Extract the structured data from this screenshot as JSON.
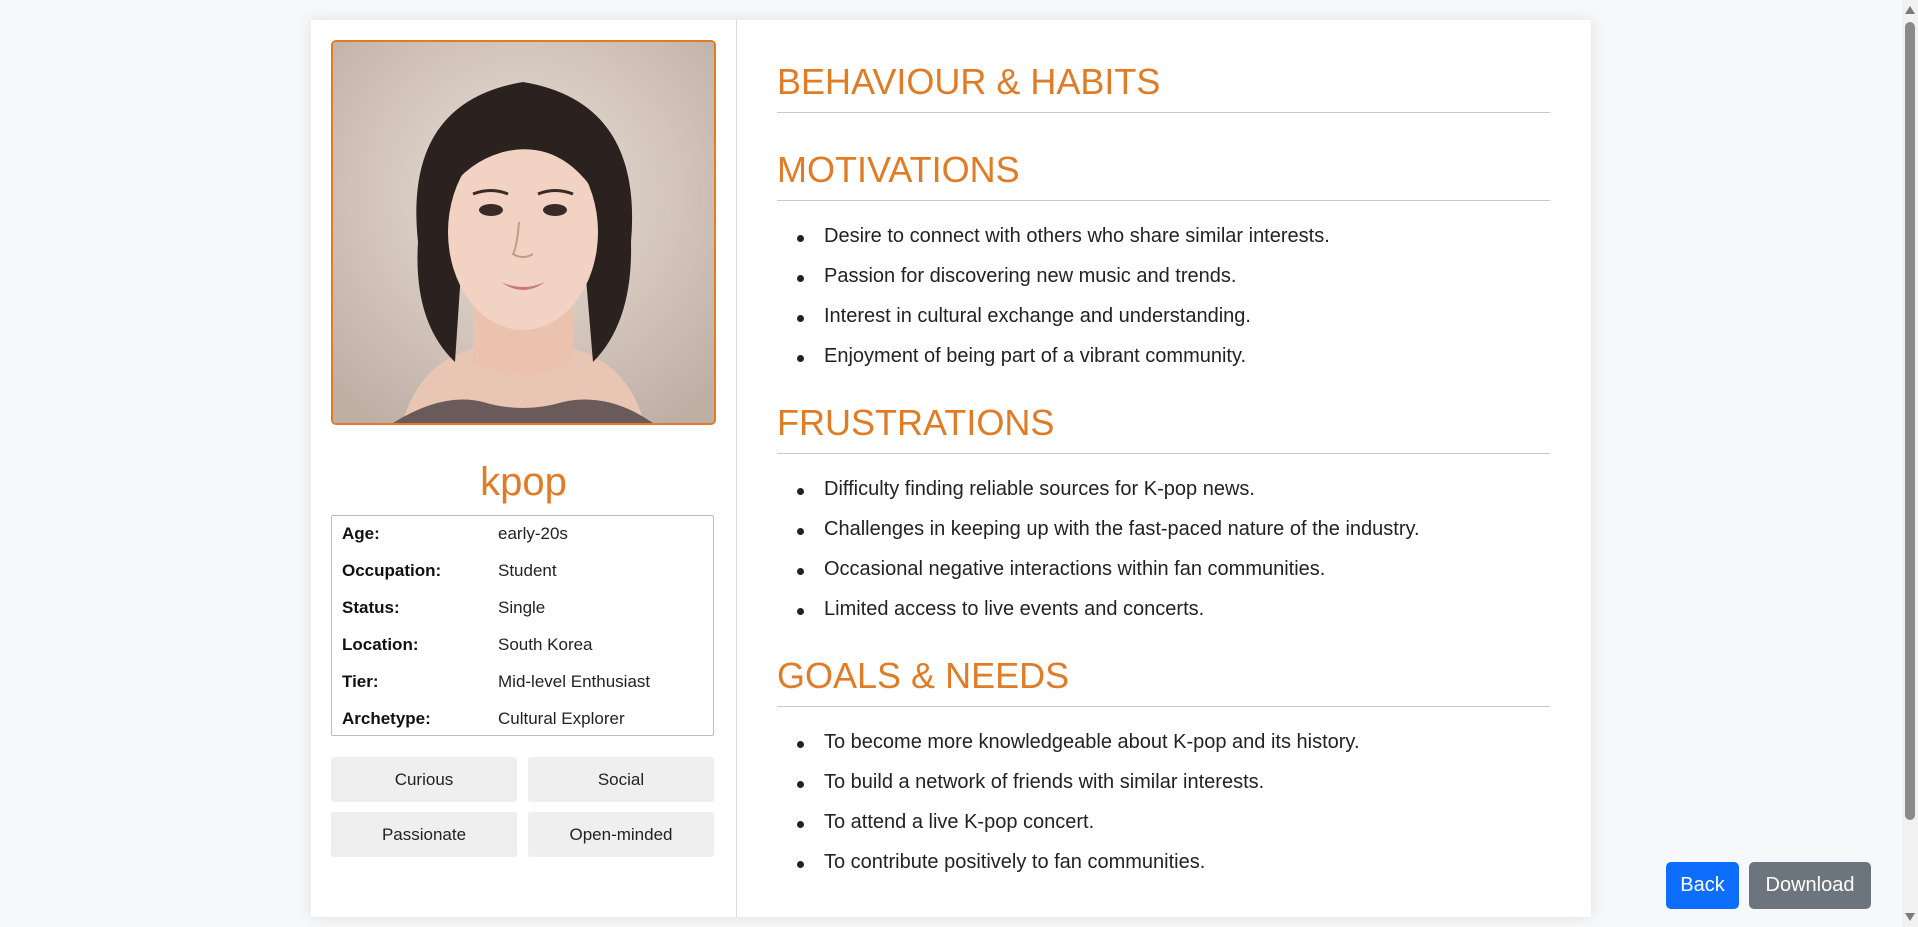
{
  "persona": {
    "name": "kpop",
    "info": [
      {
        "label": "Age:",
        "value": "early-20s"
      },
      {
        "label": "Occupation:",
        "value": "Student"
      },
      {
        "label": "Status:",
        "value": "Single"
      },
      {
        "label": "Location:",
        "value": "South Korea"
      },
      {
        "label": "Tier:",
        "value": "Mid-level Enthusiast"
      },
      {
        "label": "Archetype:",
        "value": "Cultural Explorer"
      }
    ],
    "traits": [
      "Curious",
      "Social",
      "Passionate",
      "Open-minded"
    ]
  },
  "sections": {
    "behaviour": {
      "title": "BEHAVIOUR & HABITS",
      "items": []
    },
    "motivations": {
      "title": "MOTIVATIONS",
      "items": [
        "Desire to connect with others who share similar interests.",
        "Passion for discovering new music and trends.",
        "Interest in cultural exchange and understanding.",
        "Enjoyment of being part of a vibrant community."
      ]
    },
    "frustrations": {
      "title": "FRUSTRATIONS",
      "items": [
        "Difficulty finding reliable sources for K-pop news.",
        "Challenges in keeping up with the fast-paced nature of the industry.",
        "Occasional negative interactions within fan communities.",
        "Limited access to live events and concerts."
      ]
    },
    "goals": {
      "title": "GOALS & NEEDS",
      "items": [
        "To become more knowledgeable about K-pop and its history.",
        "To build a network of friends with similar interests.",
        "To attend a live K-pop concert.",
        "To contribute positively to fan communities."
      ]
    }
  },
  "actions": {
    "back": "Back",
    "download": "Download"
  },
  "colors": {
    "accent": "#e07b26",
    "back_button": "#0d6efd",
    "download_button": "#6c757d"
  }
}
